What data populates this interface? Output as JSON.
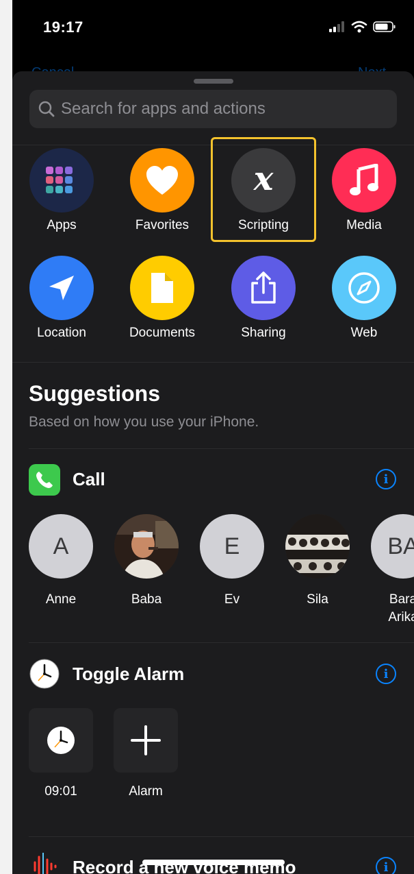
{
  "status_bar": {
    "time": "19:17"
  },
  "behind": {
    "cancel": "Cancel",
    "next": "Next"
  },
  "search": {
    "placeholder": "Search for apps and actions"
  },
  "categories": [
    {
      "label": "Apps",
      "icon": "apps-grid-icon",
      "color": "#1c2748"
    },
    {
      "label": "Favorites",
      "icon": "heart-icon",
      "color": "#ff9500"
    },
    {
      "label": "Scripting",
      "icon": "scripting-x-icon",
      "color": "#3a3a3c",
      "highlighted": true,
      "highlight_color": "#f4c22d"
    },
    {
      "label": "Media",
      "icon": "music-note-icon",
      "color": "#ff2d55"
    },
    {
      "label": "Location",
      "icon": "location-arrow-icon",
      "color": "#2f7cf6"
    },
    {
      "label": "Documents",
      "icon": "document-icon",
      "color": "#ffcc00"
    },
    {
      "label": "Sharing",
      "icon": "share-icon",
      "color": "#5e5ce6"
    },
    {
      "label": "Web",
      "icon": "compass-icon",
      "color": "#5ac8fa"
    }
  ],
  "suggestions": {
    "title": "Suggestions",
    "subtitle": "Based on how you use your iPhone.",
    "call": {
      "title": "Call",
      "info_glyph": "i",
      "contacts": [
        {
          "name": "Anne",
          "initials": "A"
        },
        {
          "name": "Baba",
          "initials": ""
        },
        {
          "name": "Ev",
          "initials": "E"
        },
        {
          "name": "Sila",
          "initials": ""
        },
        {
          "name": "Bara",
          "name_line2": "Arika",
          "initials": "BA"
        }
      ]
    },
    "toggle_alarm": {
      "title": "Toggle Alarm",
      "info_glyph": "i",
      "items": [
        {
          "label": "09:01",
          "icon": "clock-icon"
        },
        {
          "label": "Alarm",
          "icon": "plus-icon"
        }
      ]
    },
    "voice_memo": {
      "title": "Record a new voice memo",
      "info_glyph": "i"
    }
  }
}
